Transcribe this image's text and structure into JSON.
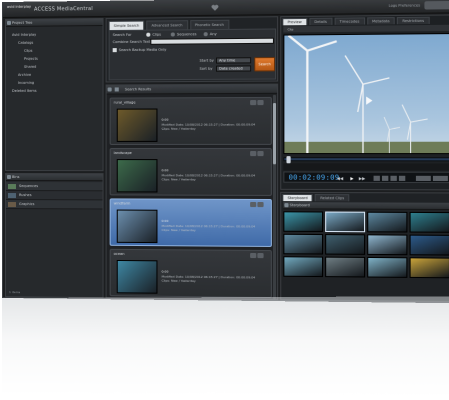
{
  "titlebar": {
    "brand": "avid interplay",
    "app_name": "ACCESS  MediaCentral",
    "right_text": "Logs  Preferences"
  },
  "left_top": {
    "header": "Project Tree",
    "tree": [
      "Avid Interplay",
      "Catalogs",
      "Clips",
      "Projects",
      "Shared",
      "Archive",
      "Incoming",
      "Deleted Items"
    ]
  },
  "left_bottom": {
    "header": "Bins",
    "items": [
      "Sequences",
      "Rushes",
      "Graphics"
    ],
    "status": "1 items"
  },
  "search": {
    "tabs": [
      "Simple Search",
      "Advanced Search",
      "Phonetic Search"
    ],
    "search_label": "Search For",
    "options": [
      "Clips",
      "Sequences",
      "Any"
    ],
    "field_label": "Combine Search Text",
    "field_value": "",
    "checkbox_label": "Search Backup Media Only",
    "date_label": "Start by",
    "date_value": "Any time",
    "sort_label": "Sort by",
    "sort_value": "Date created",
    "search_button": "Search"
  },
  "results": {
    "header": "Search Results",
    "clips": [
      {
        "title": "rural_village",
        "dur": "0:00",
        "meta1": "Modified Date: 10/08/2012 06:15:27 | Duration: 00:00:09:04",
        "meta2": "Clips: New / Yesterday",
        "thumb": "#6e5a2a"
      },
      {
        "title": "landscape",
        "dur": "0:00",
        "meta1": "Modified Date: 10/08/2012 06:15:27 | Duration: 00:00:09:04",
        "meta2": "Clips: New / Yesterday",
        "thumb": "#3c6a4a"
      },
      {
        "title": "windfarm",
        "dur": "0:00",
        "meta1": "Modified Date: 10/08/2012 06:15:27 | Duration: 00:00:09:04",
        "meta2": "Clips: New / Yesterday",
        "thumb": "#6c8fae"
      },
      {
        "title": "ocean",
        "dur": "0:00",
        "meta1": "Modified Date: 10/08/2012 06:15:27 | Duration: 00:00:09:04",
        "meta2": "Clips: New / Yesterday",
        "thumb": "#3e87a3"
      },
      {
        "title": "sunflower",
        "dur": "0:00",
        "meta1": "Modified Date: 10/08/2012 06:15:27 | Duration: 00:00:09:04",
        "meta2": "Clips: New / Yesterday",
        "thumb": "#5b7b2e"
      },
      {
        "title": "rainbow_mountains",
        "dur": "0:00",
        "meta1": "Modified Date: 10/08/2012 06:15:27",
        "meta2": "Clips: New / Yesterday",
        "thumb": "#5a6e3a"
      }
    ]
  },
  "player": {
    "tabs": [
      "Preview",
      "Details",
      "Timecodes",
      "Metadata",
      "Restrictions"
    ],
    "clip_label": "Clip",
    "timecode": "00:02:09:09"
  },
  "storyboard": {
    "tabs": [
      "Storyboard",
      "Related Clips"
    ],
    "header": "Storyboard",
    "frames": [
      "#3b95a8",
      "#7aa8c4",
      "#5d88a0",
      "#2e7f8e",
      "#5e8aa0",
      "#3f5f6e",
      "#8fb6cf",
      "#2c5a8a",
      "#72aac0",
      "#6f7e84",
      "#7fb1c6",
      "#c9a33a"
    ]
  },
  "colors": {
    "accent": "#49a8f0",
    "selected_clip": "#3f6aa8",
    "search_button": "#d06a20"
  }
}
